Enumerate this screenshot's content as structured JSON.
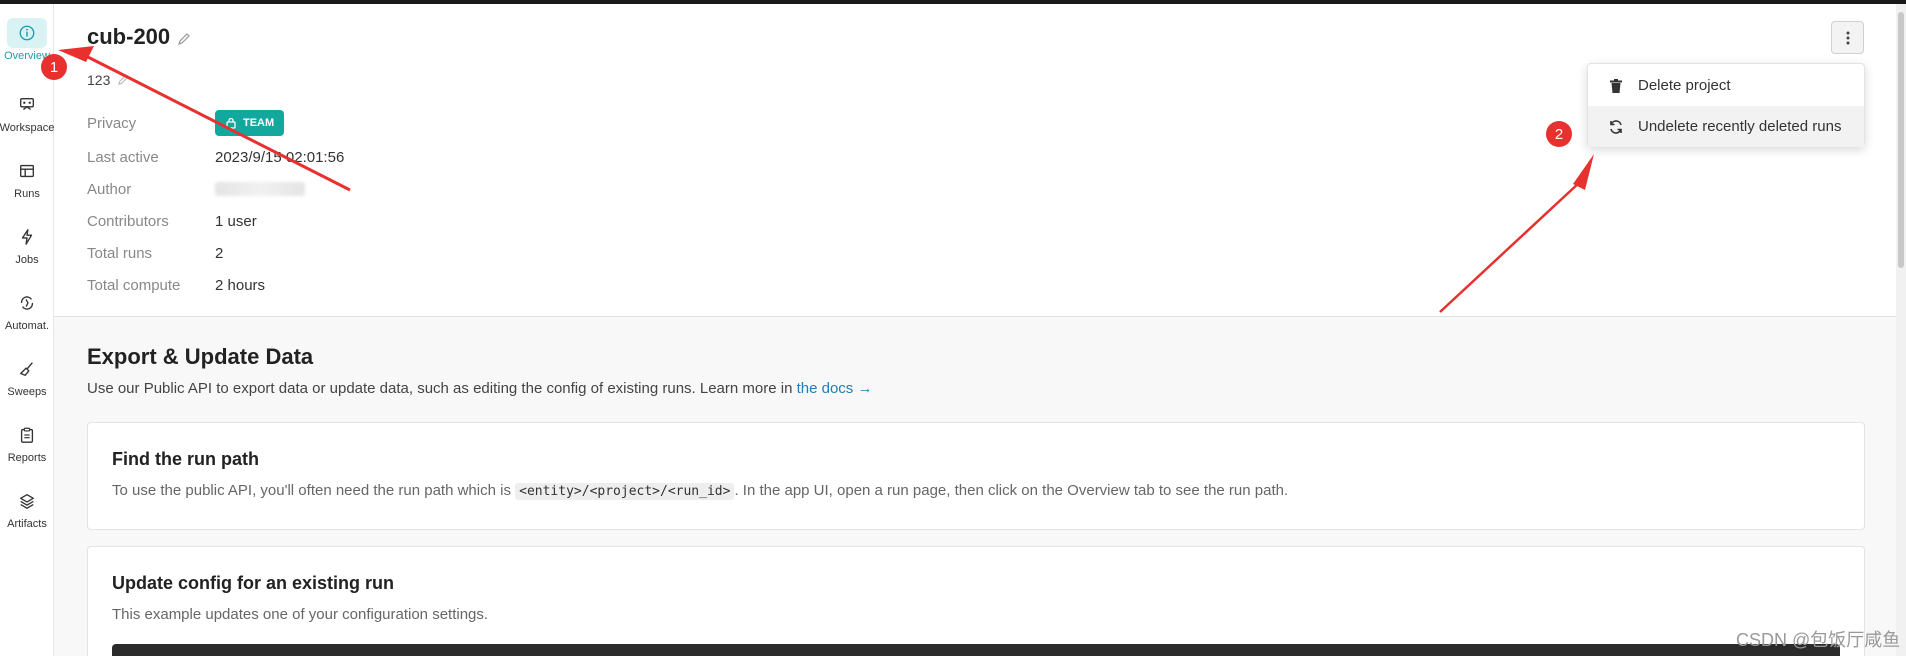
{
  "sidebar": {
    "items": [
      {
        "label": "Overview",
        "icon": "info-icon",
        "active": true
      },
      {
        "label": "Workspace",
        "icon": "workspace-icon",
        "active": false
      },
      {
        "label": "Runs",
        "icon": "table-icon",
        "active": false
      },
      {
        "label": "Jobs",
        "icon": "lightning-icon",
        "active": false
      },
      {
        "label": "Automat.",
        "icon": "automation-icon",
        "active": false
      },
      {
        "label": "Sweeps",
        "icon": "broom-icon",
        "active": false
      },
      {
        "label": "Reports",
        "icon": "clipboard-icon",
        "active": false
      },
      {
        "label": "Artifacts",
        "icon": "layers-icon",
        "active": false
      }
    ]
  },
  "project": {
    "title": "cub-200",
    "description": "123",
    "info": [
      {
        "key": "Privacy",
        "value": "TEAM"
      },
      {
        "key": "Last active",
        "value": "2023/9/15 02:01:56"
      },
      {
        "key": "Author",
        "value": ""
      },
      {
        "key": "Contributors",
        "value": "1 user"
      },
      {
        "key": "Total runs",
        "value": "2"
      },
      {
        "key": "Total compute",
        "value": "2 hours"
      }
    ]
  },
  "menu": {
    "items": [
      {
        "label": "Delete project",
        "icon": "trash-icon"
      },
      {
        "label": "Undelete recently deleted runs",
        "icon": "refresh-icon"
      }
    ]
  },
  "export": {
    "title": "Export & Update Data",
    "desc": "Use our Public API to export data or update data, such as editing the config of existing runs. Learn more in ",
    "link": "the docs →",
    "cards": [
      {
        "title": "Find the run path",
        "desc_before": "To use the public API, you'll often need the run path which is ",
        "code": "<entity>/<project>/<run_id>",
        "desc_after": ". In the app UI, open a run page, then click on the Overview tab to see the run path."
      },
      {
        "title": "Update config for an existing run",
        "desc": "This example updates one of your configuration settings."
      }
    ]
  },
  "annotations": {
    "badge1": "1",
    "badge2": "2",
    "color": "#e8302f"
  },
  "watermark": "CSDN @包饭厅咸鱼"
}
